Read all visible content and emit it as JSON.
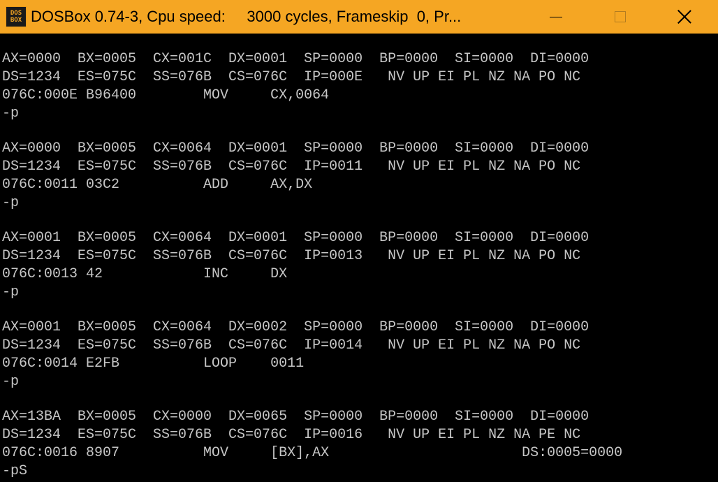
{
  "window": {
    "title": "DOSBox 0.74-3, Cpu speed:     3000 cycles, Frameskip  0, Pr...",
    "icon_top": "DOS",
    "icon_bottom": "BOX",
    "icon_name": "dosbox-icon",
    "accent_color": "#f5a623"
  },
  "controls": {
    "minimize": "minimize-icon",
    "maximize": "maximize-icon",
    "close": "close-icon"
  },
  "console": {
    "lines": [
      "AX=0000  BX=0005  CX=001C  DX=0001  SP=0000  BP=0000  SI=0000  DI=0000",
      "DS=1234  ES=075C  SS=076B  CS=076C  IP=000E   NV UP EI PL NZ NA PO NC",
      "076C:000E B96400        MOV     CX,0064",
      "-p",
      "",
      "AX=0000  BX=0005  CX=0064  DX=0001  SP=0000  BP=0000  SI=0000  DI=0000",
      "DS=1234  ES=075C  SS=076B  CS=076C  IP=0011   NV UP EI PL NZ NA PO NC",
      "076C:0011 03C2          ADD     AX,DX",
      "-p",
      "",
      "AX=0001  BX=0005  CX=0064  DX=0001  SP=0000  BP=0000  SI=0000  DI=0000",
      "DS=1234  ES=075C  SS=076B  CS=076C  IP=0013   NV UP EI PL NZ NA PO NC",
      "076C:0013 42            INC     DX",
      "-p",
      "",
      "AX=0001  BX=0005  CX=0064  DX=0002  SP=0000  BP=0000  SI=0000  DI=0000",
      "DS=1234  ES=075C  SS=076B  CS=076C  IP=0014   NV UP EI PL NZ NA PO NC",
      "076C:0014 E2FB          LOOP    0011",
      "-p",
      "",
      "AX=13BA  BX=0005  CX=0000  DX=0065  SP=0000  BP=0000  SI=0000  DI=0000",
      "DS=1234  ES=075C  SS=076B  CS=076C  IP=0016   NV UP EI PL NZ NA PE NC",
      "076C:0016 8907          MOV     [BX],AX                       DS:0005=0000",
      "-pS"
    ]
  }
}
